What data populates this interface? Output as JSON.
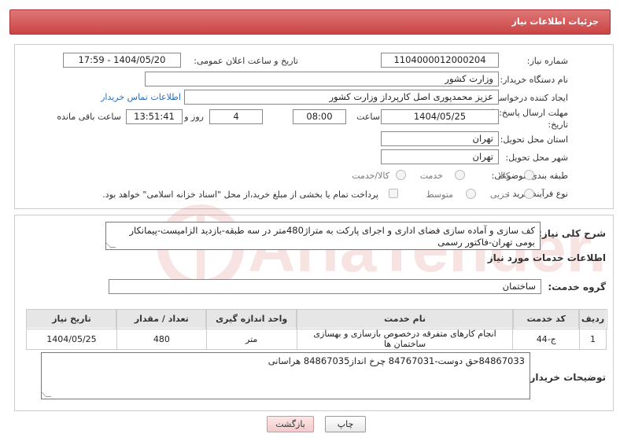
{
  "header": {
    "title": "جزئیات اطلاعات نیاز"
  },
  "need": {
    "number_label": "شماره نیاز:",
    "number_value": "1104000012000204",
    "announce_label": "تاریخ و ساعت اعلان عمومی:",
    "announce_value": "1404/05/20 - 17:59",
    "buyer_label": "نام دستگاه خریدار:",
    "buyer_value": "وزارت کشور",
    "creator_label": "ایجاد کننده درخواست:",
    "creator_value": "عزیز محمدپوری اصل کارپرداز وزارت کشور",
    "contact_link": "اطلاعات تماس خریدار",
    "deadline_label": "مهلت ارسال پاسخ: تا تاریخ:",
    "deadline_date": "1404/05/25",
    "time_label": "ساعت",
    "deadline_time": "08:00",
    "days_value": "4",
    "days_label": "روز و",
    "remaining_value": "13:51:41",
    "remaining_label": "ساعت باقی مانده",
    "province_label": "استان محل تحویل:",
    "province_value": "تهران",
    "city_label": "شهر محل تحویل:",
    "city_value": "تهران",
    "category_label": "طبقه بندی موضوعی:",
    "category_options": [
      "کالا",
      "خدمت",
      "کالا/خدمت"
    ],
    "process_label": "نوع فرآیند خرید :",
    "process_options": [
      "جزیی",
      "متوسط"
    ],
    "payment_note": "پرداخت تمام یا بخشی از مبلغ خرید،از محل \"اسناد خزانه اسلامی\" خواهد بود."
  },
  "description": {
    "label": "شرح کلی نیاز:",
    "text": "کف سازی و آماده سازی فضای اداری و اجرای پارکت به متراژ480متر در سه طبقه-بازدید الزامیست-پیمانکار بومی تهران-فاکتور رسمی"
  },
  "services": {
    "section_title": "اطلاعات خدمات مورد نیاز",
    "group_label": "گروه خدمت:",
    "group_value": "ساختمان",
    "columns": [
      "ردیف",
      "کد خدمت",
      "نام خدمت",
      "واحد اندازه گیری",
      "تعداد / مقدار",
      "تاریخ نیاز"
    ],
    "rows": [
      [
        "1",
        "ج-44",
        "انجام کارهای متفرقه درخصوص بازسازی و بهسازی ساختمان ها",
        "متر",
        "480",
        "1404/05/25"
      ]
    ]
  },
  "buyer_notes": {
    "label": "توضیحات خریدار:",
    "text": "84867033حق دوست-84767031 چرخ انداز84867035 هراسانی"
  },
  "buttons": {
    "print": "چاپ",
    "back": "بازگشت"
  },
  "colors": {
    "header": "#c44",
    "link": "#2a6ebb",
    "watermark": "#c33"
  }
}
